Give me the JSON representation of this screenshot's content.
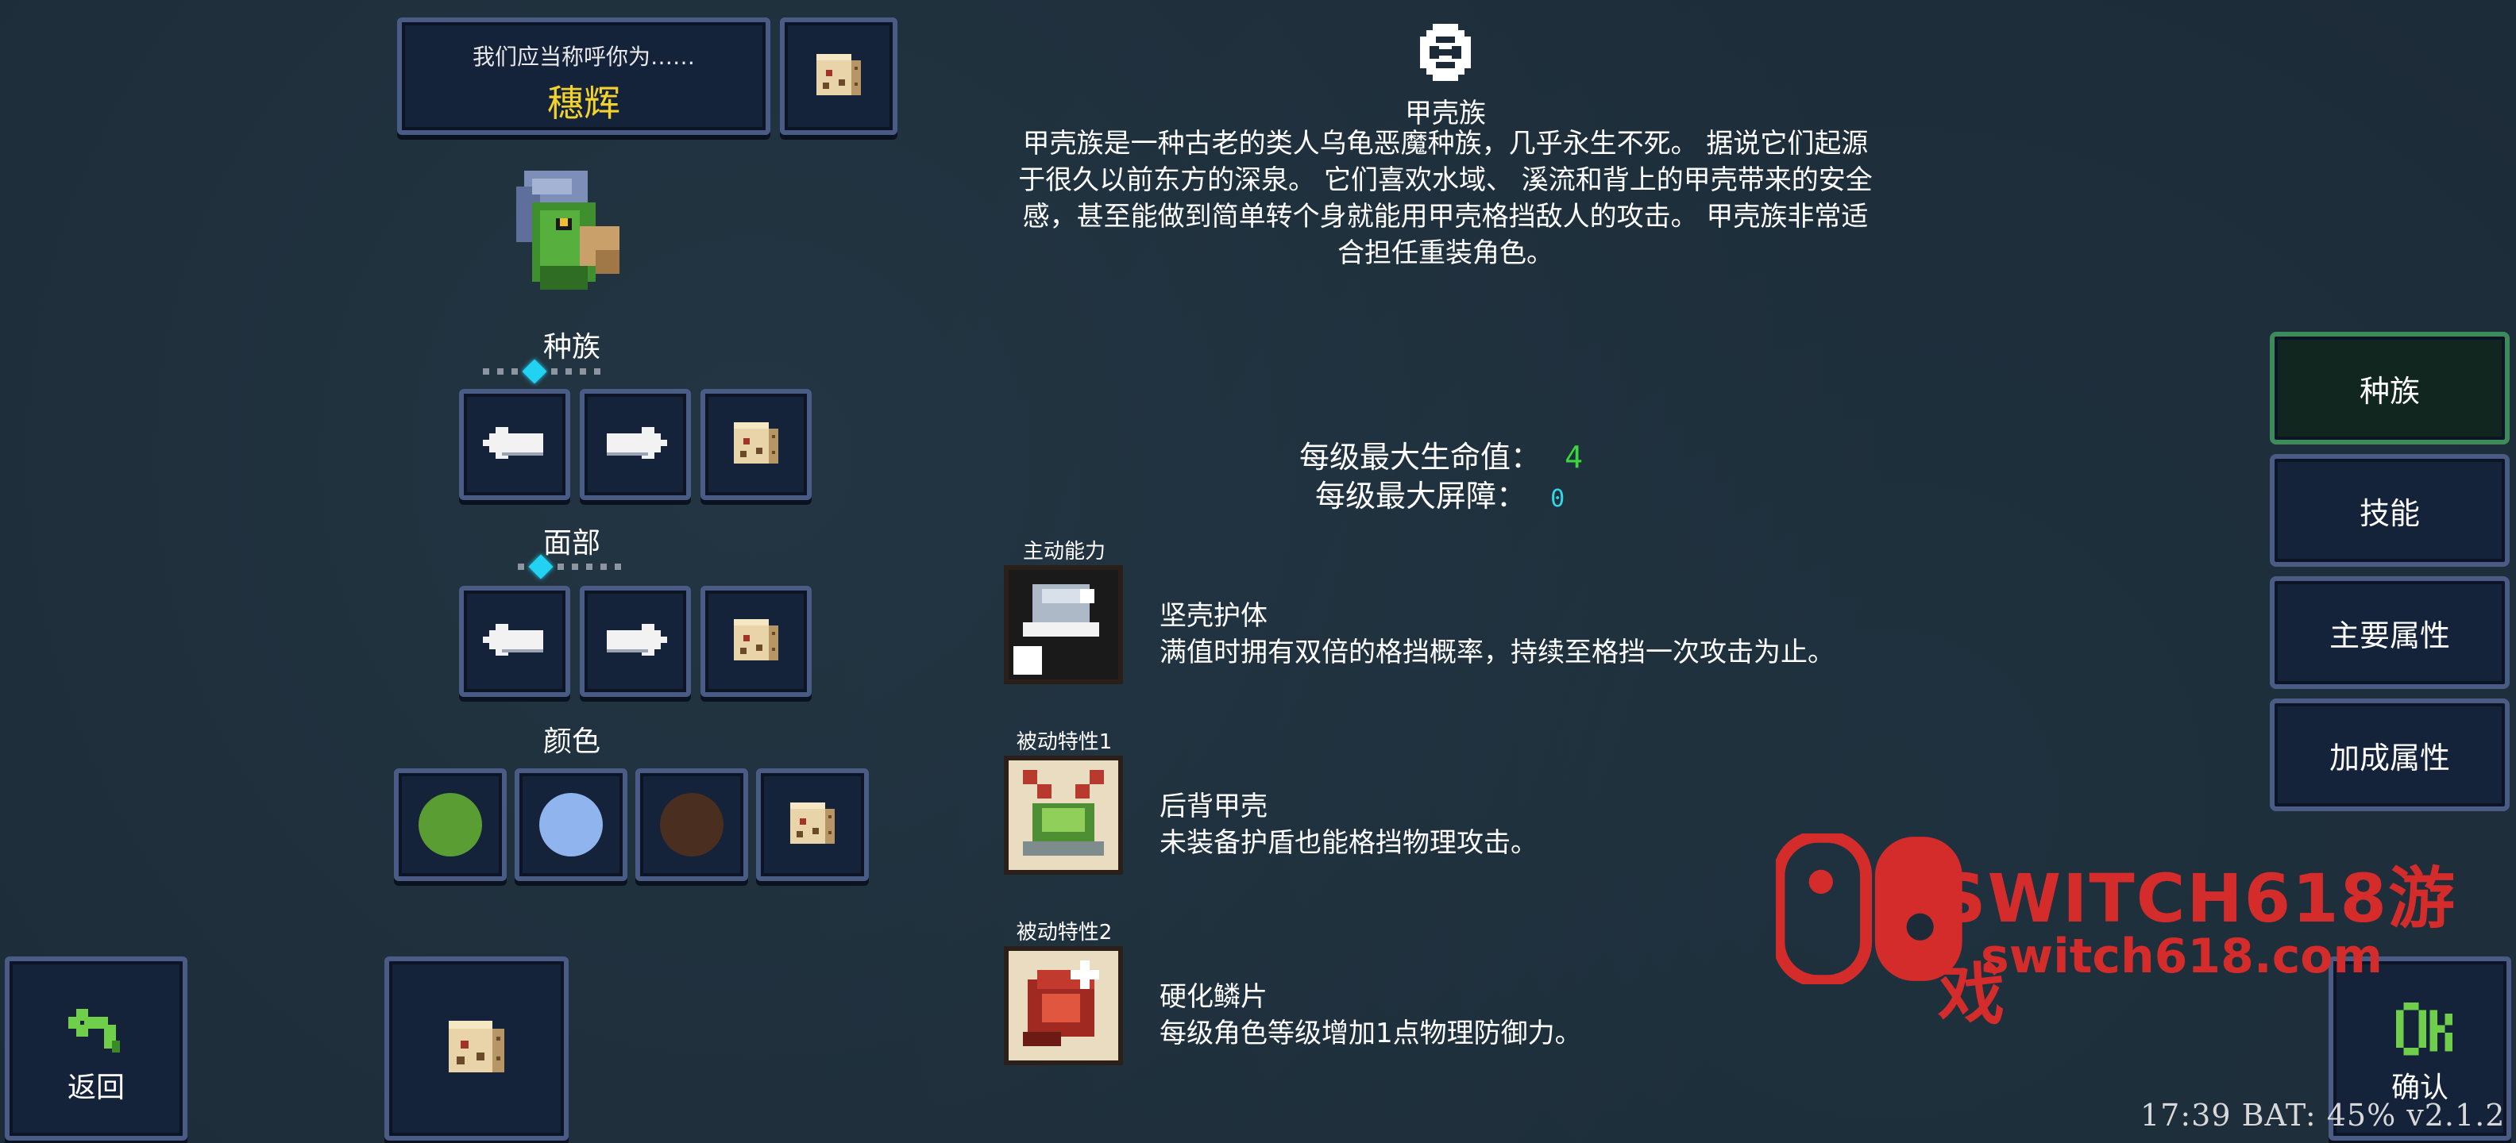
{
  "name_panel": {
    "label": "我们应当称呼你为……",
    "value": "穗辉"
  },
  "sections": {
    "race_label": "种族",
    "face_label": "面部",
    "color_label": "颜色"
  },
  "race_slider": {
    "count": 8,
    "active_index": 3
  },
  "face_slider": {
    "count": 7,
    "active_index": 1
  },
  "color_swatches": [
    "#5a9e33",
    "#8fb4ee",
    "#4a2e1f"
  ],
  "race_icon": {
    "name": "shell-icon",
    "title": "甲壳族"
  },
  "description": "甲壳族是一种古老的类人乌龟恶魔种族，几乎永生不死。 据说它们起源于很久以前东方的深泉。 它们喜欢水域、 溪流和背上的甲壳带来的安全感，甚至能做到简单转个身就能用甲壳格挡敌人的攻击。 甲壳族非常适合担任重装角色。",
  "description_lines": [
    "甲壳族是一种古老的类人乌龟恶魔种族，几乎永生不死。 据说它们起源",
    "于很久以前东方的深泉。 它们喜欢水域、 溪流和背上的甲壳带来的安全",
    "感，甚至能做到简单转个身就能用甲壳格挡敌人的攻击。 甲壳族非常适",
    "合担任重装角色。"
  ],
  "stats": {
    "hp_label": "每级最大生命值：",
    "hp_value": "4",
    "barrier_label": "每级最大屏障：",
    "barrier_value": "0",
    "hp_color": "#3ad83a",
    "barrier_color": "#33d6e6"
  },
  "abilities": [
    {
      "tag": "主动能力",
      "name": "坚壳护体",
      "desc": "满值时拥有双倍的格挡概率，持续至格挡一次攻击为止。",
      "icon": "shell-guard-icon"
    },
    {
      "tag": "被动特性1",
      "name": "后背甲壳",
      "desc": "未装备护盾也能格挡物理攻击。",
      "icon": "back-shell-icon"
    },
    {
      "tag": "被动特性2",
      "name": "硬化鳞片",
      "desc": "每级角色等级增加1点物理防御力。",
      "icon": "hardened-scale-icon"
    }
  ],
  "menu": [
    {
      "label": "种族",
      "active": true
    },
    {
      "label": "技能",
      "active": false
    },
    {
      "label": "主要属性",
      "active": false
    },
    {
      "label": "加成属性",
      "active": false
    }
  ],
  "buttons": {
    "back": "返回",
    "confirm": "确认"
  },
  "watermark": {
    "line1": "SWITCH618游戏",
    "line2": "switch618.com"
  },
  "status": "17:39 BAT: 45% v2.1.2",
  "colors": {
    "panel_border": "#4a5c86",
    "panel_bg": "#14233a",
    "name_color": "#f3d22b",
    "active_menu_border": "#3d8a5a"
  }
}
